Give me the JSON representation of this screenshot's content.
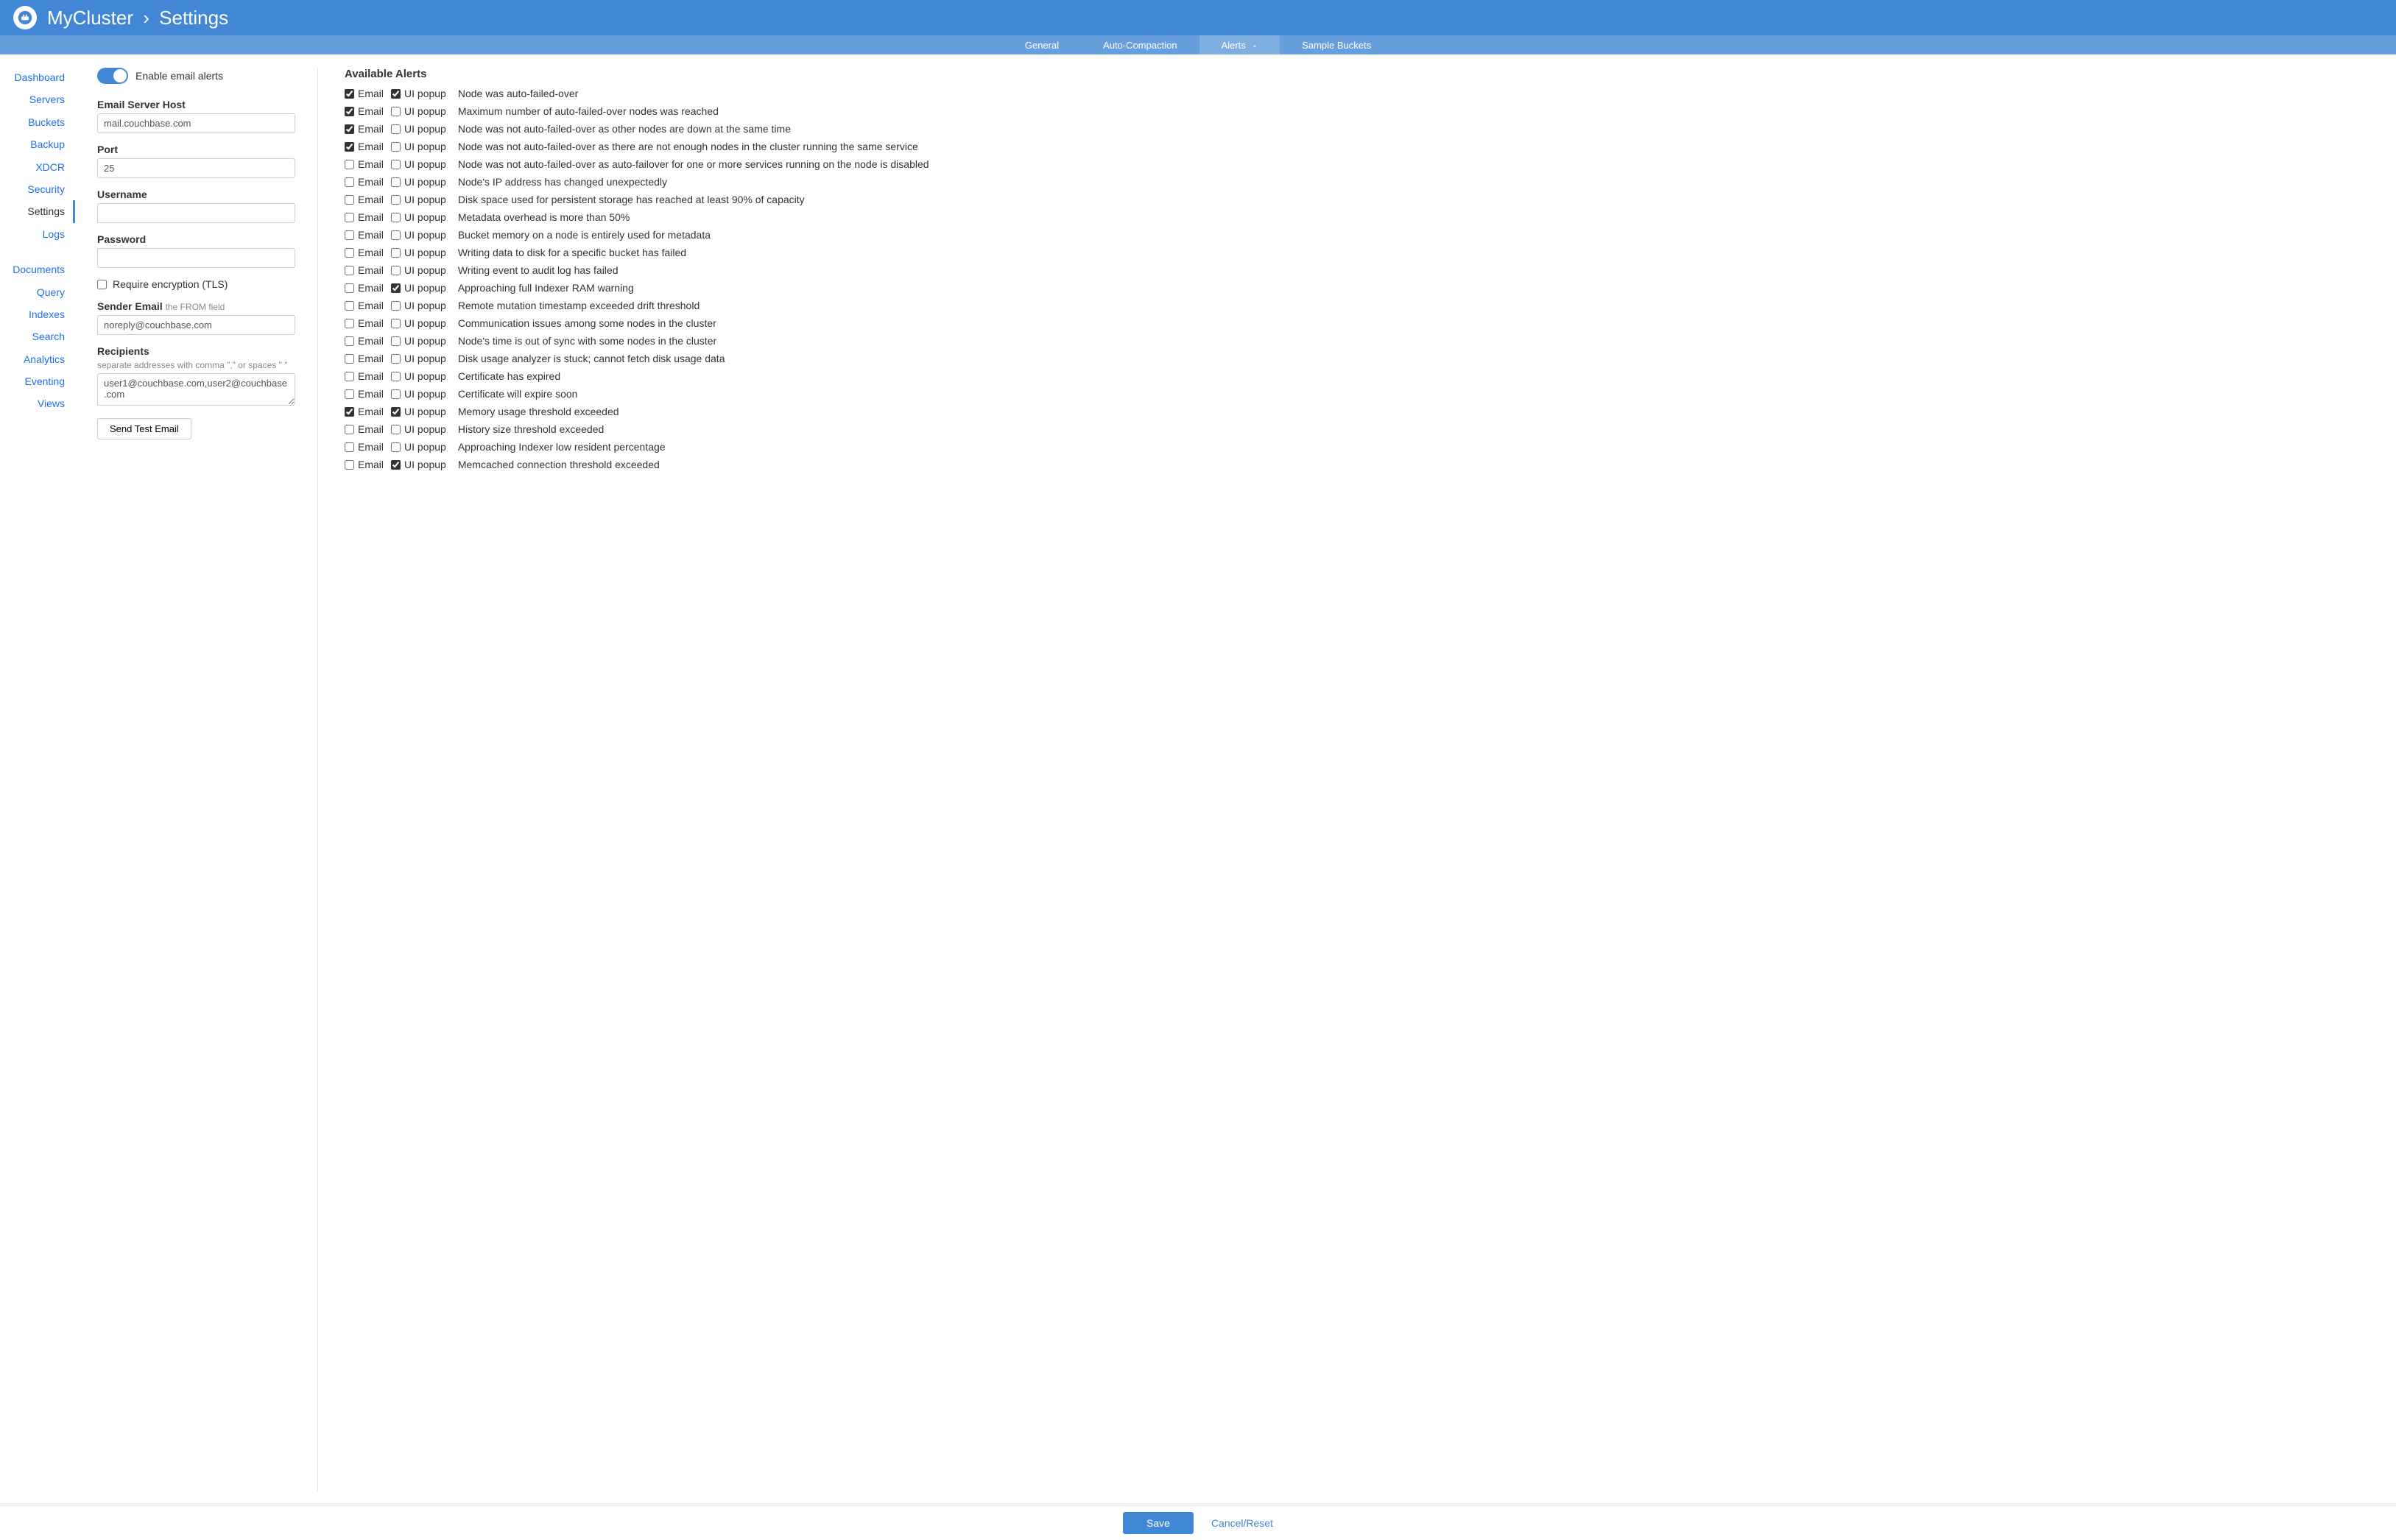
{
  "header": {
    "cluster": "MyCluster",
    "page": "Settings"
  },
  "tabs": {
    "general": "General",
    "autocompaction": "Auto-Compaction",
    "alerts": "Alerts",
    "sample": "Sample Buckets",
    "active": "alerts"
  },
  "sidebar": {
    "items": [
      "Dashboard",
      "Servers",
      "Buckets",
      "Backup",
      "XDCR",
      "Security",
      "Settings",
      "Logs"
    ],
    "items2": [
      "Documents",
      "Query",
      "Indexes",
      "Search",
      "Analytics",
      "Eventing",
      "Views"
    ],
    "active": "Settings"
  },
  "form": {
    "enable_label": "Enable email alerts",
    "host_label": "Email Server Host",
    "host": "mail.couchbase.com",
    "port_label": "Port",
    "port": "25",
    "username_label": "Username",
    "username": "",
    "password_label": "Password",
    "password": "",
    "tls_label": "Require encryption (TLS)",
    "tls_checked": false,
    "sender_label": "Sender Email",
    "sender_hint": "the FROM field",
    "sender": "noreply@couchbase.com",
    "recipients_label": "Recipients",
    "recipients_hint": "separate addresses with comma \",\" or spaces \" \"",
    "recipients": "user1@couchbase.com,user2@couchbase.com",
    "test_btn": "Send Test Email"
  },
  "alerts": {
    "title": "Available Alerts",
    "email_label": "Email",
    "popup_label": "UI popup",
    "rows": [
      {
        "email": true,
        "popup": true,
        "text": "Node was auto-failed-over"
      },
      {
        "email": true,
        "popup": false,
        "text": "Maximum number of auto-failed-over nodes was reached"
      },
      {
        "email": true,
        "popup": false,
        "text": "Node was not auto-failed-over as other nodes are down at the same time"
      },
      {
        "email": true,
        "popup": false,
        "text": "Node was not auto-failed-over as there are not enough nodes in the cluster running the same service"
      },
      {
        "email": false,
        "popup": false,
        "text": "Node was not auto-failed-over as auto-failover for one or more services running on the node is disabled"
      },
      {
        "email": false,
        "popup": false,
        "text": "Node's IP address has changed unexpectedly"
      },
      {
        "email": false,
        "popup": false,
        "text": "Disk space used for persistent storage has reached at least 90% of capacity"
      },
      {
        "email": false,
        "popup": false,
        "text": "Metadata overhead is more than 50%"
      },
      {
        "email": false,
        "popup": false,
        "text": "Bucket memory on a node is entirely used for metadata"
      },
      {
        "email": false,
        "popup": false,
        "text": "Writing data to disk for a specific bucket has failed"
      },
      {
        "email": false,
        "popup": false,
        "text": "Writing event to audit log has failed"
      },
      {
        "email": false,
        "popup": true,
        "text": "Approaching full Indexer RAM warning"
      },
      {
        "email": false,
        "popup": false,
        "text": "Remote mutation timestamp exceeded drift threshold"
      },
      {
        "email": false,
        "popup": false,
        "text": "Communication issues among some nodes in the cluster"
      },
      {
        "email": false,
        "popup": false,
        "text": "Node's time is out of sync with some nodes in the cluster"
      },
      {
        "email": false,
        "popup": false,
        "text": "Disk usage analyzer is stuck; cannot fetch disk usage data"
      },
      {
        "email": false,
        "popup": false,
        "text": "Certificate has expired"
      },
      {
        "email": false,
        "popup": false,
        "text": "Certificate will expire soon"
      },
      {
        "email": true,
        "popup": true,
        "text": "Memory usage threshold exceeded"
      },
      {
        "email": false,
        "popup": false,
        "text": "History size threshold exceeded"
      },
      {
        "email": false,
        "popup": false,
        "text": "Approaching Indexer low resident percentage"
      },
      {
        "email": false,
        "popup": true,
        "text": "Memcached connection threshold exceeded"
      }
    ]
  },
  "footer": {
    "save": "Save",
    "cancel": "Cancel/Reset"
  }
}
